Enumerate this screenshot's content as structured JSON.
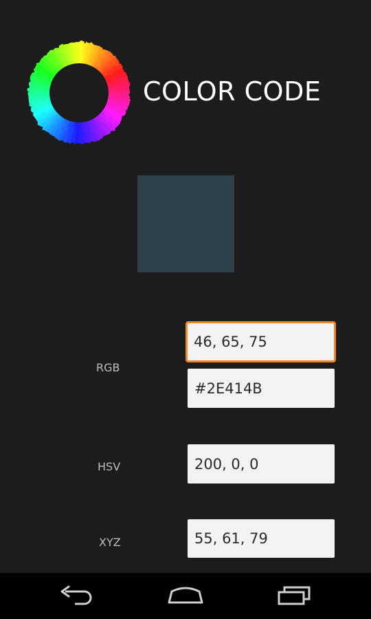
{
  "app": {
    "title": "COLOR CODE",
    "logo_icon": "color-wheel-icon"
  },
  "preview": {
    "color": "#2E414B"
  },
  "rows": {
    "rgb": {
      "label": "RGB",
      "decimal_value": "46, 65, 75",
      "hex_value": "#2E414B"
    },
    "hsv": {
      "label": "HSV",
      "value": "200, 0, 0"
    },
    "xyz": {
      "label": "XYZ",
      "value": "55, 61, 79"
    }
  },
  "nav": {
    "back_icon": "back-arrow-icon",
    "home_icon": "home-icon",
    "recents_icon": "recent-apps-icon"
  },
  "colors": {
    "background": "#1c1c1c",
    "focus_border": "#f0861e",
    "field_bg": "#f3f3f3",
    "nav_bar": "#000000"
  }
}
